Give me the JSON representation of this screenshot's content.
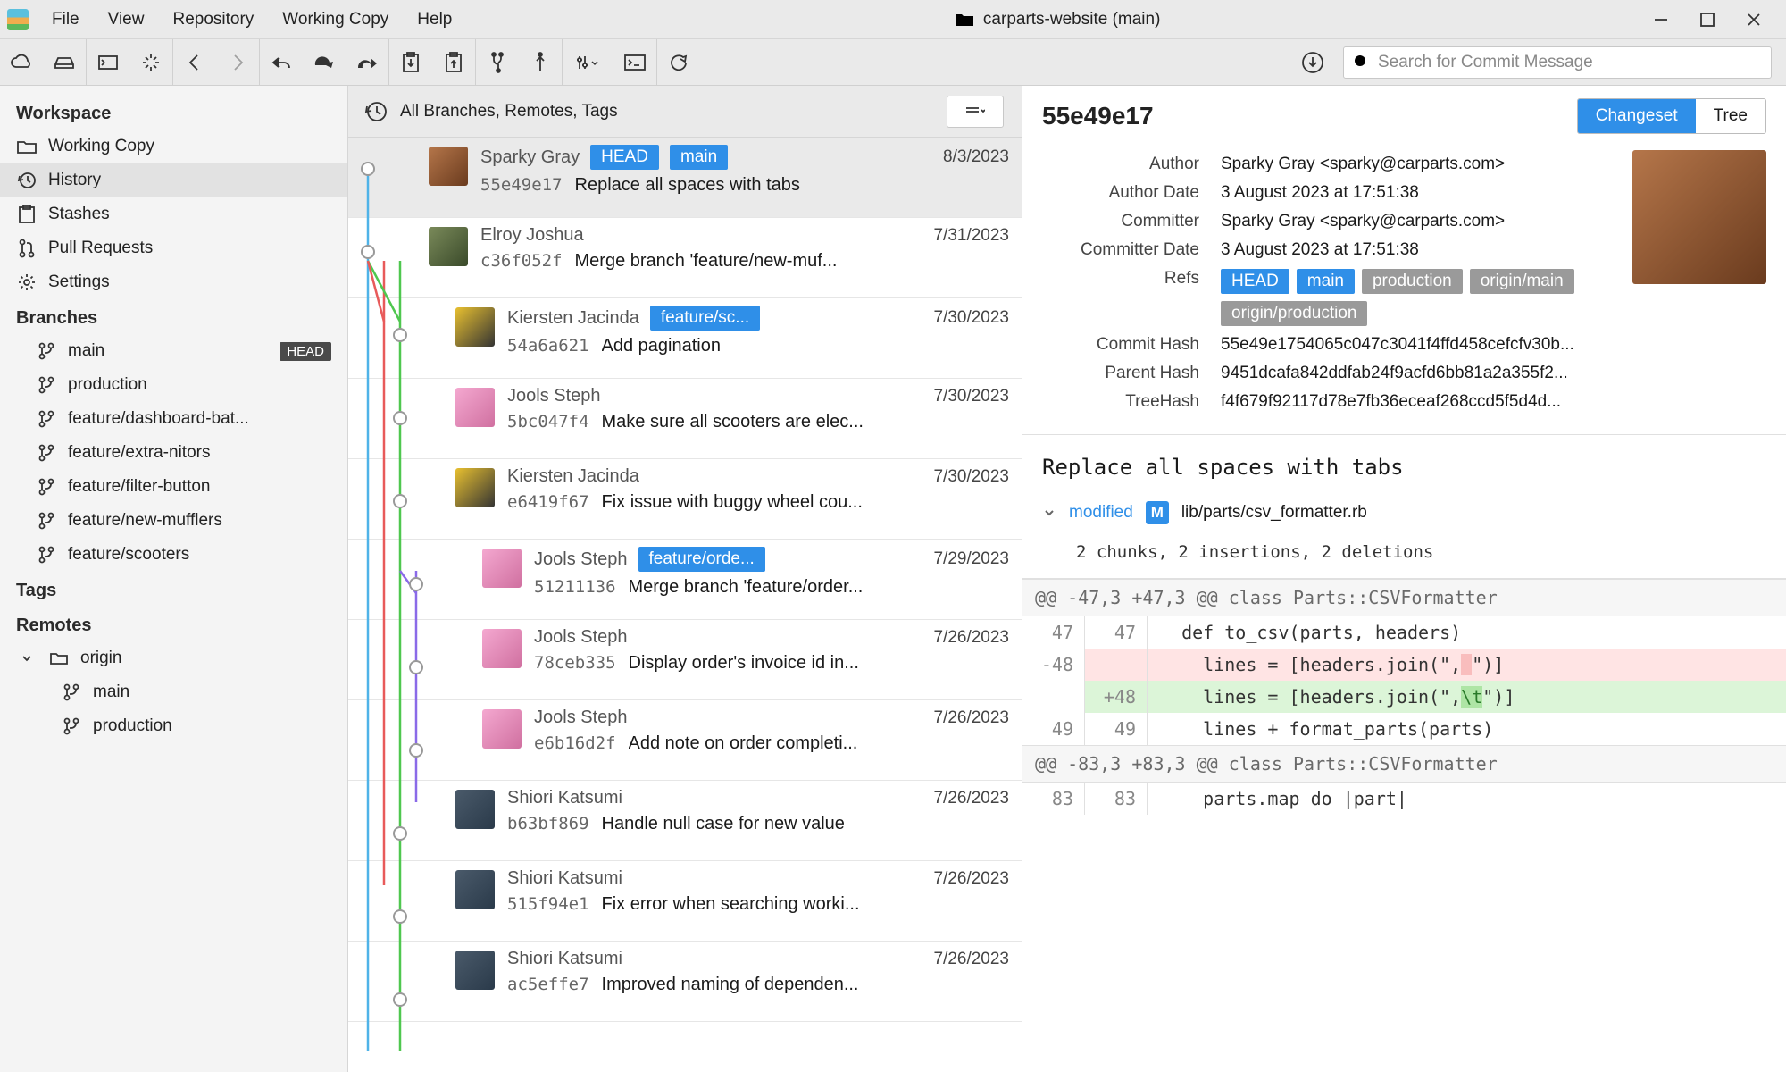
{
  "menu": {
    "file": "File",
    "view": "View",
    "repository": "Repository",
    "working_copy": "Working Copy",
    "help": "Help"
  },
  "window_title": "carparts-website (main)",
  "search_placeholder": "Search for Commit Message",
  "sidebar": {
    "workspace_heading": "Workspace",
    "working_copy": "Working Copy",
    "history": "History",
    "stashes": "Stashes",
    "pull_requests": "Pull Requests",
    "settings": "Settings",
    "branches_heading": "Branches",
    "branches": [
      {
        "name": "main",
        "head": true
      },
      {
        "name": "production"
      },
      {
        "name": "feature/dashboard-bat..."
      },
      {
        "name": "feature/extra-nitors"
      },
      {
        "name": "feature/filter-button"
      },
      {
        "name": "feature/new-mufflers"
      },
      {
        "name": "feature/scooters"
      }
    ],
    "head_badge": "HEAD",
    "tags_heading": "Tags",
    "remotes_heading": "Remotes",
    "remotes": {
      "name": "origin",
      "children": [
        "main",
        "production"
      ]
    }
  },
  "list_header_title": "All Branches, Remotes, Tags",
  "commits": [
    {
      "author": "Sparky Gray",
      "date": "8/3/2023",
      "hash": "55e49e17",
      "msg": "Replace all spaces with tabs",
      "badges": [
        "HEAD",
        "main"
      ],
      "indent": 0,
      "selected": true,
      "av": "rust"
    },
    {
      "author": "Elroy Joshua",
      "date": "7/31/2023",
      "hash": "c36f052f",
      "msg": "Merge branch 'feature/new-muf...",
      "indent": 0,
      "av": "man"
    },
    {
      "author": "Kiersten Jacinda",
      "date": "7/30/2023",
      "hash": "54a6a621",
      "msg": "Add pagination",
      "badges": [
        "feature/sc..."
      ],
      "indent": 1,
      "av": "helm"
    },
    {
      "author": "Jools Steph",
      "date": "7/30/2023",
      "hash": "5bc047f4",
      "msg": "Make sure all scooters are elec...",
      "indent": 1,
      "av": "pink"
    },
    {
      "author": "Kiersten Jacinda",
      "date": "7/30/2023",
      "hash": "e6419f67",
      "msg": "Fix issue with buggy wheel cou...",
      "indent": 1,
      "av": "helm"
    },
    {
      "author": "Jools Steph",
      "date": "7/29/2023",
      "hash": "51211136",
      "msg": "Merge branch 'feature/order...",
      "badges": [
        "feature/orde..."
      ],
      "indent": 2,
      "av": "pink"
    },
    {
      "author": "Jools Steph",
      "date": "7/26/2023",
      "hash": "78ceb335",
      "msg": "Display order's invoice id in...",
      "indent": 2,
      "av": "pink"
    },
    {
      "author": "Jools Steph",
      "date": "7/26/2023",
      "hash": "e6b16d2f",
      "msg": "Add note on order completi...",
      "indent": 2,
      "av": "pink"
    },
    {
      "author": "Shiori Katsumi",
      "date": "7/26/2023",
      "hash": "b63bf869",
      "msg": "Handle null case for new value",
      "indent": 1,
      "av": "shop"
    },
    {
      "author": "Shiori Katsumi",
      "date": "7/26/2023",
      "hash": "515f94e1",
      "msg": "Fix error when searching worki...",
      "indent": 1,
      "av": "shop"
    },
    {
      "author": "Shiori Katsumi",
      "date": "7/26/2023",
      "hash": "ac5effe7",
      "msg": "Improved naming of dependen...",
      "indent": 1,
      "av": "shop"
    }
  ],
  "detail": {
    "hash_short": "55e49e17",
    "tabs": {
      "changeset": "Changeset",
      "tree": "Tree"
    },
    "labels": {
      "author": "Author",
      "author_date": "Author Date",
      "committer": "Committer",
      "committer_date": "Committer Date",
      "refs": "Refs",
      "commit_hash": "Commit Hash",
      "parent_hash": "Parent Hash",
      "tree_hash": "TreeHash"
    },
    "author": "Sparky Gray <sparky@carparts.com>",
    "author_date": "3 August 2023 at 17:51:38",
    "committer": "Sparky Gray <sparky@carparts.com>",
    "committer_date": "3 August 2023 at 17:51:38",
    "refs_local": [
      "HEAD",
      "main"
    ],
    "refs_remote": [
      "production",
      "origin/main",
      "origin/production"
    ],
    "commit_hash": "55e49e1754065c047c3041f4ffd458cefcfv30b...",
    "parent_hash": "9451dcafa842ddfab24f9acfd6bb81a2a355f2...",
    "tree_hash": "f4f679f92117d78e7fb36eceaf268ccd5f5d4d...",
    "commit_msg": "Replace all spaces with tabs",
    "file": {
      "status": "modified",
      "badge": "M",
      "path": "lib/parts/csv_formatter.rb"
    },
    "chunks_summary": "2 chunks, 2 insertions, 2 deletions",
    "hunks": [
      {
        "header": "@@ -47,3 +47,3 @@ class Parts::CSVFormatter",
        "lines": [
          {
            "a": "47",
            "b": "47",
            "t": "ctx",
            "code": "  def to_csv(parts, headers)"
          },
          {
            "a": "-48",
            "b": "",
            "t": "del",
            "code": "    lines = [headers.join(\",",
            "hl": " ",
            "tail": "\")]"
          },
          {
            "a": "",
            "b": "+48",
            "t": "add",
            "code": "    lines = [headers.join(\",",
            "hl": "\\t",
            "tail": "\")]"
          },
          {
            "a": "49",
            "b": "49",
            "t": "ctx",
            "code": "    lines + format_parts(parts)"
          }
        ]
      },
      {
        "header": "@@ -83,3 +83,3 @@ class Parts::CSVFormatter",
        "lines": [
          {
            "a": "83",
            "b": "83",
            "t": "ctx",
            "code": "    parts.map do |part|"
          }
        ]
      }
    ]
  }
}
